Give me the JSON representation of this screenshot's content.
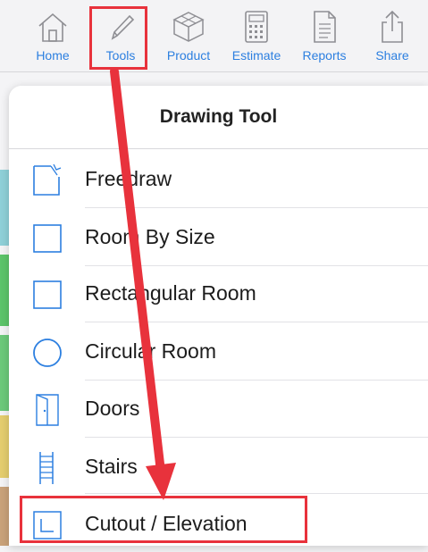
{
  "toolbar": {
    "items": [
      {
        "label": "Home",
        "icon": "home-icon"
      },
      {
        "label": "Tools",
        "icon": "pencil-icon"
      },
      {
        "label": "Product",
        "icon": "box-icon"
      },
      {
        "label": "Estimate",
        "icon": "calculator-icon"
      },
      {
        "label": "Reports",
        "icon": "document-icon"
      },
      {
        "label": "Share",
        "icon": "share-icon"
      }
    ]
  },
  "popover": {
    "title": "Drawing Tool",
    "items": [
      {
        "label": "Freedraw",
        "icon": "freedraw-icon"
      },
      {
        "label": "Room By Size",
        "icon": "square-icon"
      },
      {
        "label": "Rectangular Room",
        "icon": "rectangle-icon"
      },
      {
        "label": "Circular Room",
        "icon": "circle-icon"
      },
      {
        "label": "Doors",
        "icon": "door-icon"
      },
      {
        "label": "Stairs",
        "icon": "stairs-icon"
      },
      {
        "label": "Cutout / Elevation",
        "icon": "cutout-icon"
      }
    ]
  },
  "colors": {
    "accent": "#2c7fe0",
    "highlight": "#e8323c",
    "icon_gray": "#8e8e93"
  }
}
